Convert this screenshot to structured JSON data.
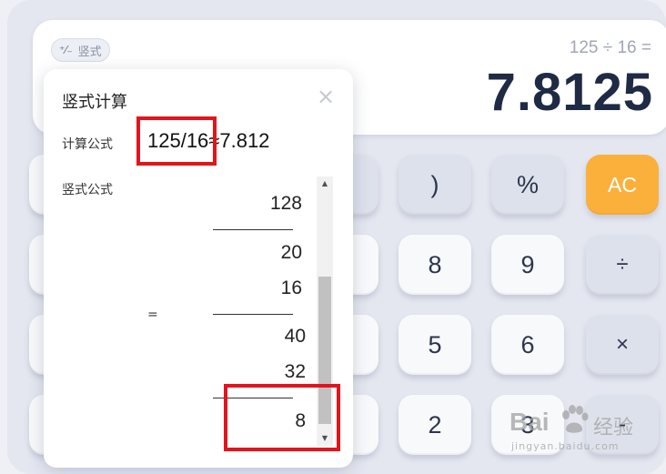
{
  "display": {
    "mode_chip": {
      "icon": "fraction-icon",
      "label": "竖式"
    },
    "expression": "125 ÷ 16 =",
    "result": "7.8125"
  },
  "keypad": {
    "row1": [
      "",
      ")",
      "%",
      "AC"
    ],
    "row2": [
      "8",
      "9",
      "÷"
    ],
    "row3": [
      "5",
      "6",
      "×"
    ],
    "row4": [
      "2",
      "3",
      "-"
    ]
  },
  "popup": {
    "title": "竖式计算",
    "close_icon": "close-icon",
    "formula_label": "计算公式",
    "formula_value": "125/16≈7.812",
    "vertical_label": "竖式公式",
    "equals_sign": "=",
    "vertical_rows": [
      "128",
      "20",
      "16",
      "40",
      "32",
      "8"
    ]
  },
  "watermark": {
    "text": "Bai",
    "cn": "经验",
    "sub": "jingyan.baidu.com"
  },
  "colors": {
    "accent_ac": "#fbb03b",
    "highlight_box": "#e3141c",
    "result_text": "#1f2a44"
  }
}
